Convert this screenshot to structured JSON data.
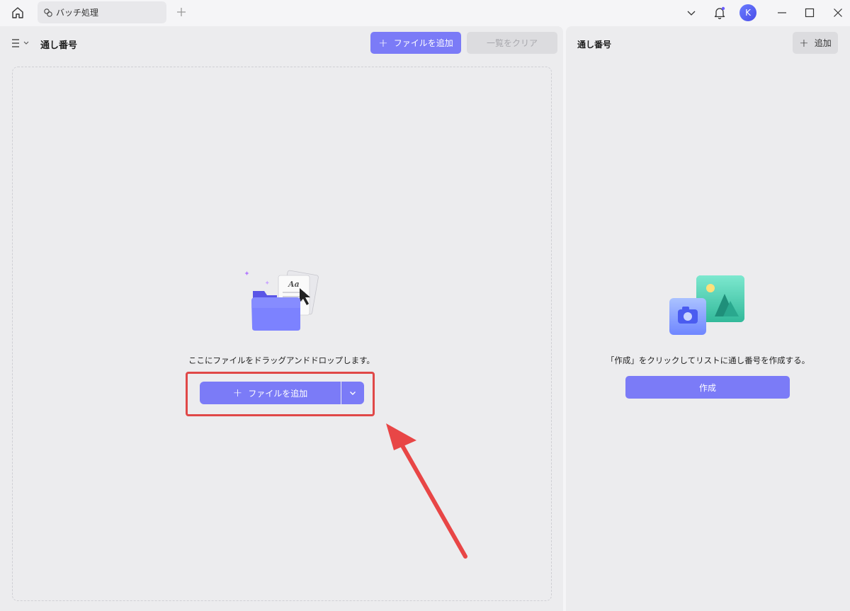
{
  "titlebar": {
    "tab_label": "バッチ処理",
    "avatar_letter": "K"
  },
  "left_panel": {
    "title": "通し番号",
    "add_file_button": "ファイルを追加",
    "clear_list_button": "一覧をクリア",
    "drop_hint": "ここにファイルをドラッグアンドドロップします。",
    "center_add_button": "ファイルを追加"
  },
  "right_panel": {
    "title": "通し番号",
    "add_button": "追加",
    "hint": "「作成」をクリックしてリストに通し番号を作成する。",
    "create_button": "作成"
  },
  "colors": {
    "accent": "#7b7bf7",
    "annotation_red": "#e04848"
  }
}
